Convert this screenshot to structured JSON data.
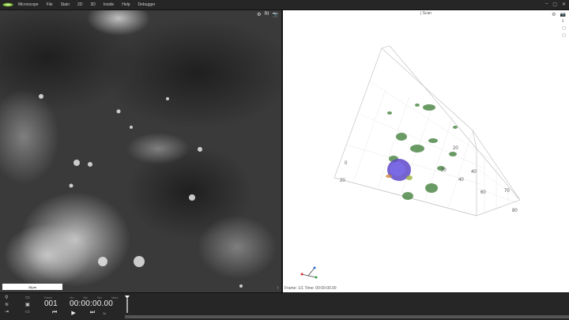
{
  "menubar": {
    "logo_icon": "leaf-logo",
    "items": [
      "Microscope",
      "File",
      "Stain",
      "2D",
      "3D",
      "Inside",
      "Help",
      "Debugger"
    ]
  },
  "left_view": {
    "tools": [
      "⚙",
      "RI",
      "📷"
    ],
    "scalebar_label": "20µm",
    "corner_icon": "arrow-up-icon"
  },
  "right_view": {
    "title": "| Scan",
    "tools": [
      "⚙",
      "📷"
    ],
    "side_tools": [
      "ℹ",
      "▢",
      "▢"
    ],
    "frame_info": "Frame: 1/1   Time: 00:00:00.00",
    "axis_ticks": [
      "20",
      "40",
      "60",
      "70",
      "80",
      "20",
      "40",
      "0",
      "20"
    ]
  },
  "bottom": {
    "frame_label": "Frame",
    "frame_value": "001",
    "time_labels": [
      "Hrs",
      "Min",
      "Sec",
      "Msec"
    ],
    "time_value": "00:00:00.00",
    "speed": "1x",
    "accent": "#2fa8ff"
  }
}
